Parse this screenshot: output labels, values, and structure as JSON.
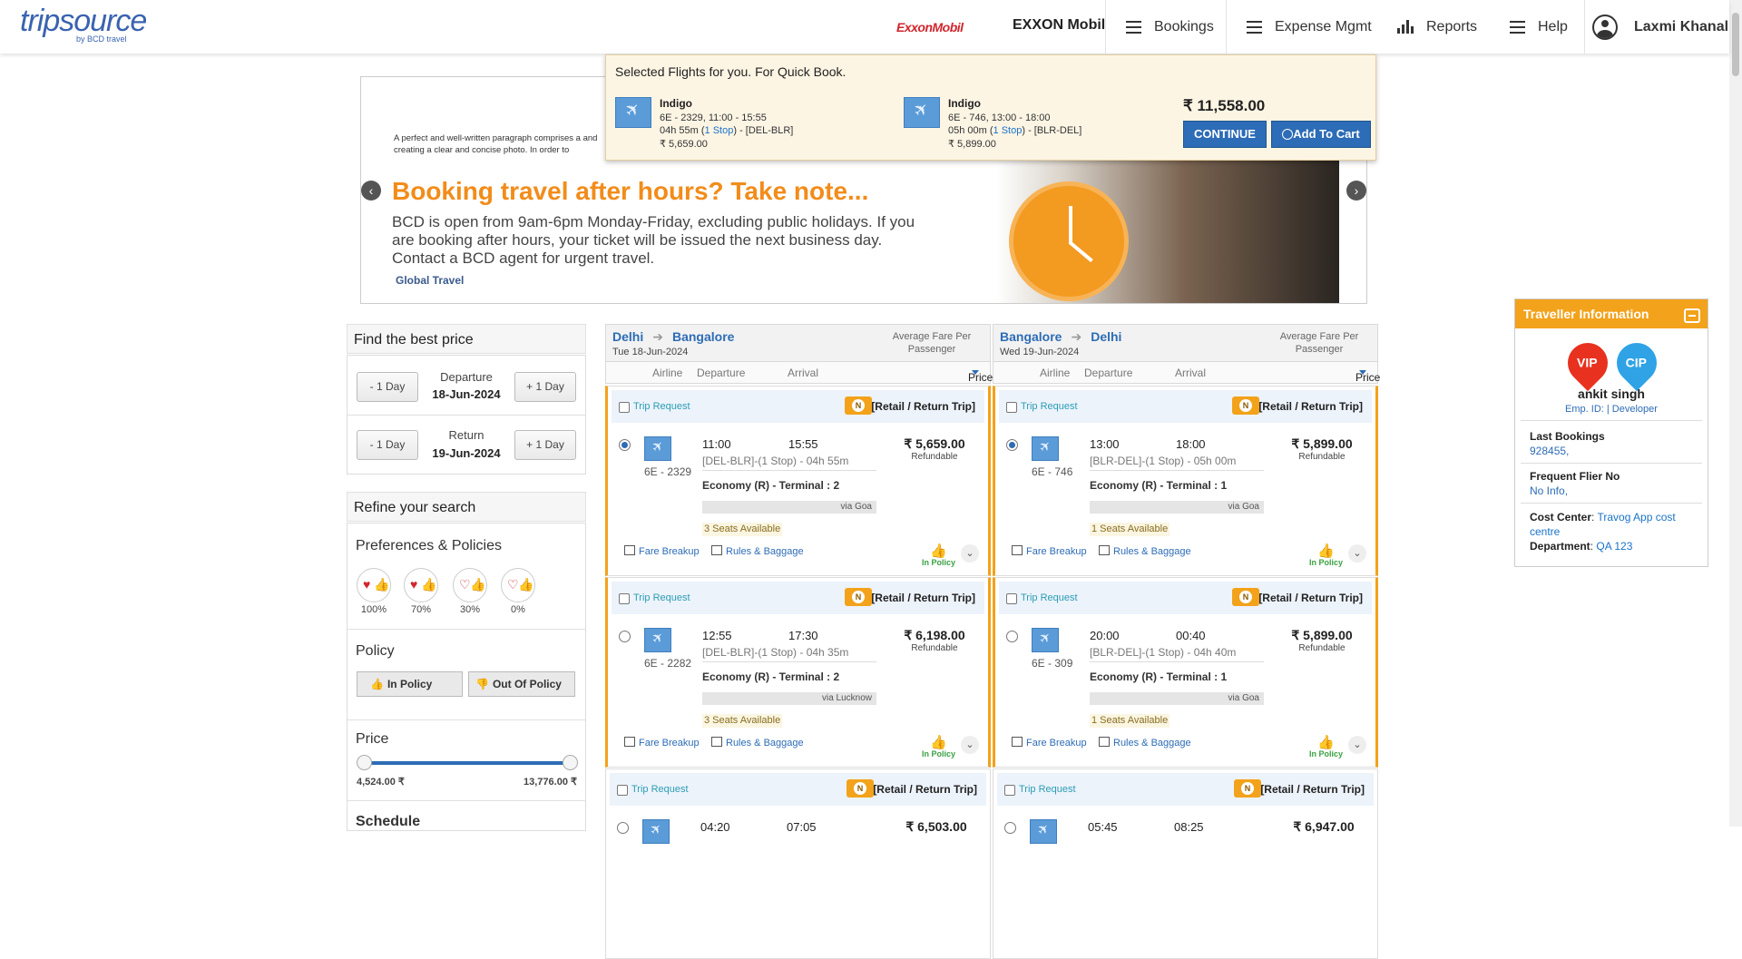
{
  "header": {
    "logo": "tripsource",
    "logo_sub": "by BCD travel",
    "company_logo": "ExxonMobil",
    "company_name": "EXXON Mobil",
    "nav": {
      "bookings": "Bookings",
      "expense": "Expense Mgmt",
      "reports": "Reports",
      "help": "Help"
    },
    "user": "Laxmi Khanal"
  },
  "banner": {
    "small_text": "A perfect and well-written paragraph comprises a and creating a clear and concise photo. In order to",
    "title": "Booking travel after hours? Take note...",
    "body": "BCD is open from 9am-6pm Monday-Friday, excluding public holidays. If you are booking after hours, your ticket will be issued the next business day. Contact a BCD agent for urgent travel.",
    "footer": "Global Travel",
    "prev": "‹",
    "next": "›"
  },
  "quick_book": {
    "heading": "Selected Flights for you. For Quick Book.",
    "outbound": {
      "airline": "Indigo",
      "line1": "6E - 2329, 11:00 - 15:55",
      "duration": "04h 55m (",
      "stops": "1 Stop",
      "route": ") - [DEL-BLR]",
      "price": "₹ 5,659.00"
    },
    "return": {
      "airline": "Indigo",
      "line1": "6E - 746, 13:00 - 18:00",
      "duration": "05h 00m (",
      "stops": "1 Stop",
      "route": ") - [BLR-DEL]",
      "price": "₹ 5,899.00"
    },
    "total": "₹ 11,558.00",
    "continue": "CONTINUE",
    "add_to_cart": "Add To Cart"
  },
  "best_price": {
    "title": "Find the best price",
    "minus": "- 1 Day",
    "plus": "+ 1 Day",
    "departure_label": "Departure",
    "departure_date": "18-Jun-2024",
    "return_label": "Return",
    "return_date": "19-Jun-2024"
  },
  "refine": {
    "title": "Refine your search",
    "prefs_title": "Preferences & Policies",
    "prefs": [
      "100%",
      "70%",
      "30%",
      "0%"
    ],
    "policy_title": "Policy",
    "in_policy": "In Policy",
    "out_policy": "Out Of Policy",
    "price_title": "Price",
    "price_min": "4,524.00 ₹",
    "price_max": "13,776.00 ₹",
    "schedule_title": "Schedule"
  },
  "outbound": {
    "from": "Delhi",
    "to": "Bangalore",
    "date": "Tue 18-Jun-2024",
    "avg": "Average Fare Per Passenger",
    "cols": {
      "airline": "Airline",
      "departure": "Departure",
      "arrival": "Arrival",
      "price": "Price"
    },
    "flights": [
      {
        "trip": "Trip Request",
        "fare": "[Retail / Return Trip]",
        "no": "6E - 2329",
        "dep": "11:00",
        "arr": "15:55",
        "route": "[DEL-BLR]-(1 Stop) - 04h 55m",
        "cls": "Economy (R) - Terminal : 2",
        "via": "via Goa",
        "seats": "3 Seats Available",
        "price": "₹ 5,659.00",
        "refund": "Refundable"
      },
      {
        "trip": "Trip Request",
        "fare": "[Retail / Return Trip]",
        "no": "6E - 2282",
        "dep": "12:55",
        "arr": "17:30",
        "route": "[DEL-BLR]-(1 Stop) - 04h 35m",
        "cls": "Economy (R) - Terminal : 2",
        "via": "via Lucknow",
        "seats": "3 Seats Available",
        "price": "₹ 6,198.00",
        "refund": "Refundable"
      },
      {
        "trip": "Trip Request",
        "fare": "[Retail / Return Trip]",
        "dep": "04:20",
        "arr": "07:05",
        "price": "₹ 6,503.00"
      }
    ]
  },
  "return": {
    "from": "Bangalore",
    "to": "Delhi",
    "date": "Wed 19-Jun-2024",
    "avg": "Average Fare Per Passenger",
    "cols": {
      "airline": "Airline",
      "departure": "Departure",
      "arrival": "Arrival",
      "price": "Price"
    },
    "flights": [
      {
        "trip": "Trip Request",
        "fare": "[Retail / Return Trip]",
        "no": "6E - 746",
        "dep": "13:00",
        "arr": "18:00",
        "route": "[BLR-DEL]-(1 Stop) - 05h 00m",
        "cls": "Economy (R) - Terminal : 1",
        "via": "via Goa",
        "seats": "1 Seats Available",
        "price": "₹ 5,899.00",
        "refund": "Refundable"
      },
      {
        "trip": "Trip Request",
        "fare": "[Retail / Return Trip]",
        "no": "6E - 309",
        "dep": "20:00",
        "arr": "00:40",
        "route": "[BLR-DEL]-(1 Stop) - 04h 40m",
        "cls": "Economy (R) - Terminal : 1",
        "via": "via Goa",
        "seats": "1 Seats Available",
        "price": "₹ 5,899.00",
        "refund": "Refundable"
      },
      {
        "trip": "Trip Request",
        "fare": "[Retail / Return Trip]",
        "dep": "05:45",
        "arr": "08:25",
        "price": "₹ 6,947.00"
      }
    ]
  },
  "card_common": {
    "fare_breakup": "Fare Breakup",
    "rules": "Rules & Baggage",
    "in_policy": "In Policy",
    "badge": "N"
  },
  "traveller": {
    "title": "Traveller Information",
    "vip": "VIP",
    "cip": "CIP",
    "name": "ankit singh",
    "emp": "Emp. ID: | Developer",
    "last_bookings_label": "Last Bookings",
    "last_bookings": "928455,",
    "ffn_label": "Frequent Flier No",
    "ffn": "No Info,",
    "cost_label": "Cost Center",
    "cost": "Travog App cost centre",
    "dept_label": "Department",
    "dept": "QA 123"
  },
  "colors": {
    "accent": "#2d6cb6",
    "orange": "#f3a21b",
    "policy_green": "#3aa041"
  }
}
